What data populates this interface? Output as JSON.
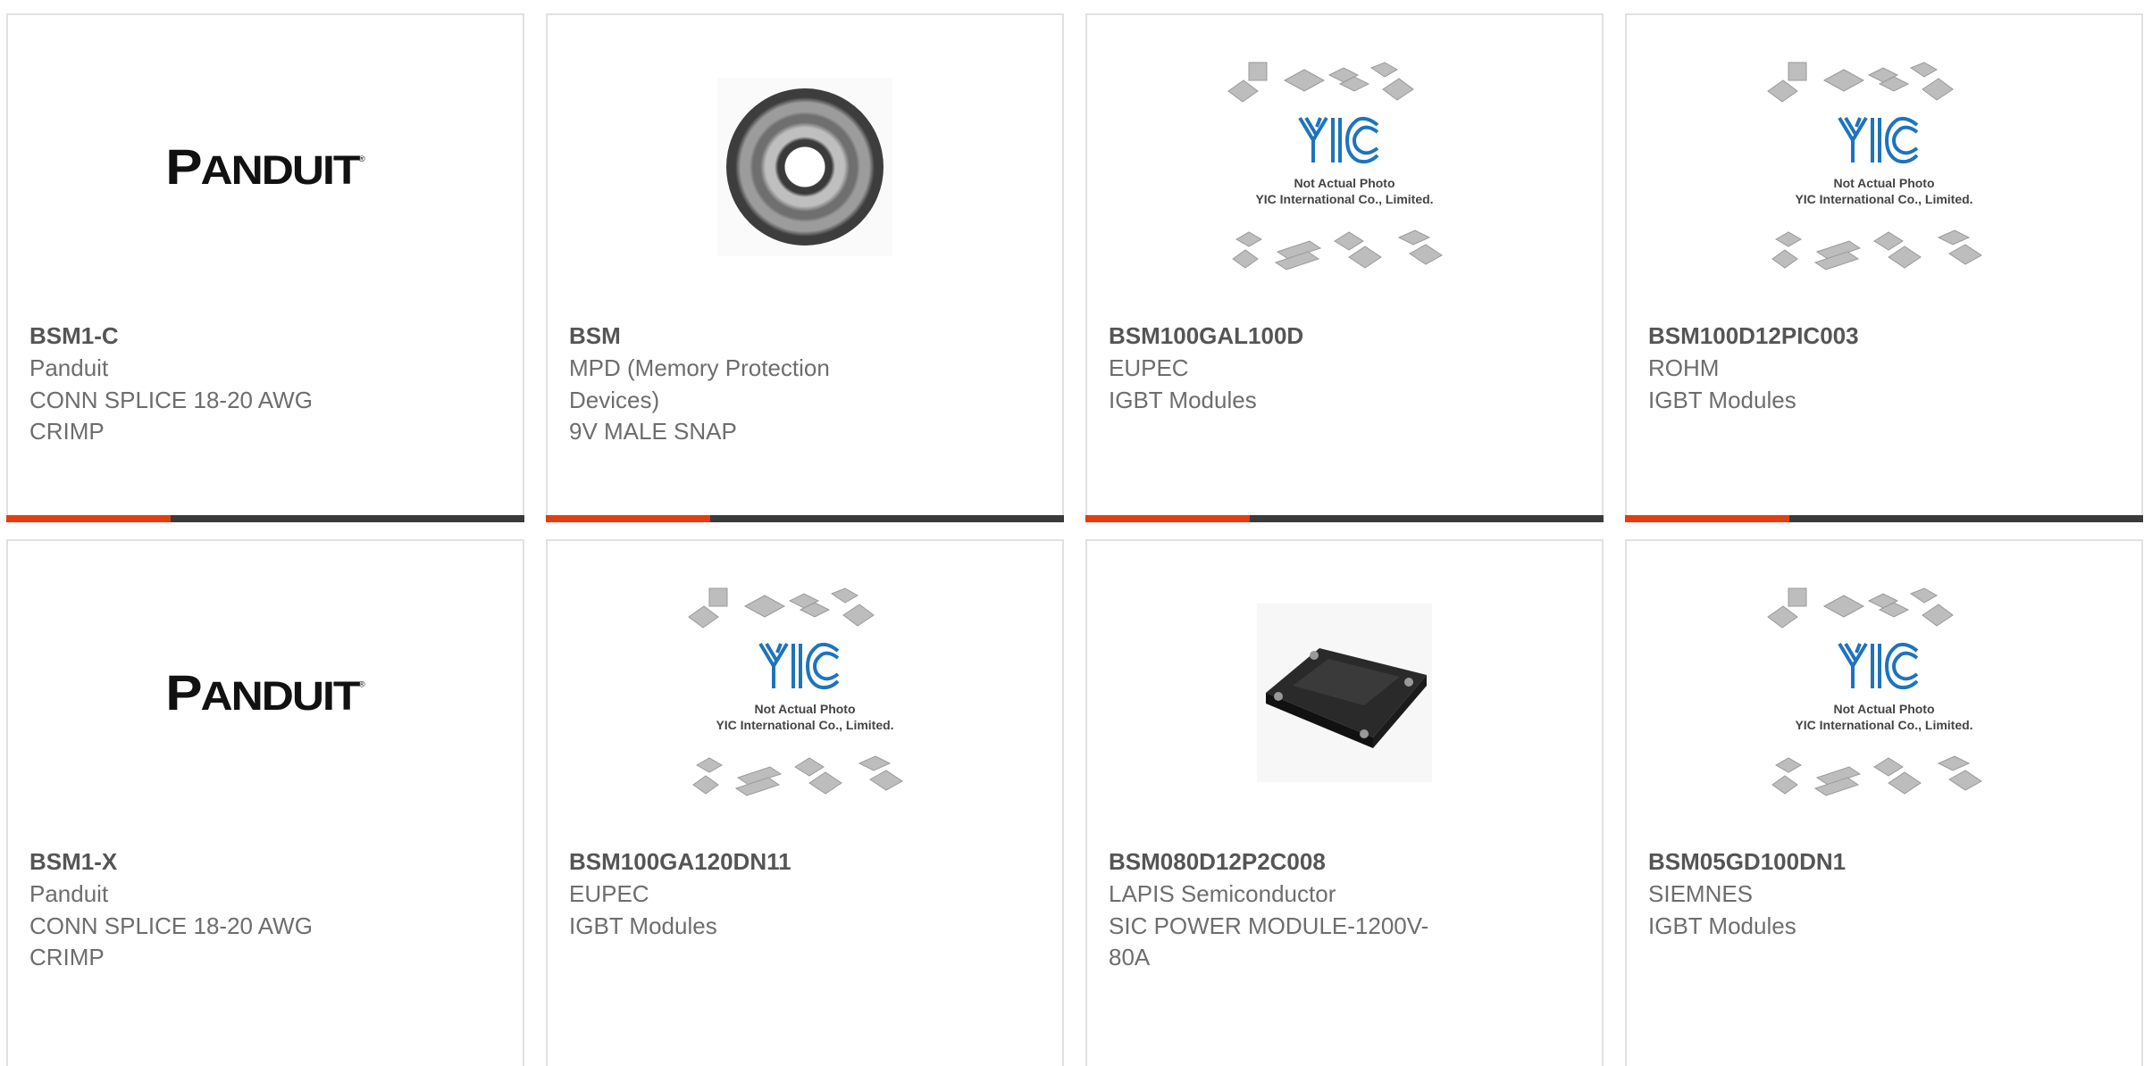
{
  "placeholder": {
    "line1": "Not Actual Photo",
    "line2": "YIC International Co., Limited.",
    "logo_text": "YIC"
  },
  "brand_logo": "PANDUIT",
  "accent_color": "#e23e0f",
  "bar_color": "#3a3a3a",
  "products": [
    {
      "part": "BSM1-C",
      "manufacturer": "Panduit",
      "description": "CONN SPLICE 18-20 AWG CRIMP",
      "image": "panduit-logo"
    },
    {
      "part": "BSM",
      "manufacturer": "MPD (Memory Protection Devices)",
      "description": "9V MALE SNAP",
      "image": "ring-photo"
    },
    {
      "part": "BSM100GAL100D",
      "manufacturer": "EUPEC",
      "description": "IGBT Modules",
      "image": "yic-placeholder"
    },
    {
      "part": "BSM100D12PIC003",
      "manufacturer": "ROHM",
      "description": "IGBT Modules",
      "image": "yic-placeholder"
    },
    {
      "part": "BSM1-X",
      "manufacturer": "Panduit",
      "description": "CONN SPLICE 18-20 AWG CRIMP",
      "image": "panduit-logo"
    },
    {
      "part": "BSM100GA120DN11",
      "manufacturer": "EUPEC",
      "description": "IGBT Modules",
      "image": "yic-placeholder"
    },
    {
      "part": "BSM080D12P2C008",
      "manufacturer": "LAPIS Semiconductor",
      "description": "SIC POWER MODULE-1200V-80A",
      "image": "igbt-module-photo"
    },
    {
      "part": "BSM05GD100DN1",
      "manufacturer": "SIEMNES",
      "description": "IGBT Modules",
      "image": "yic-placeholder"
    }
  ]
}
